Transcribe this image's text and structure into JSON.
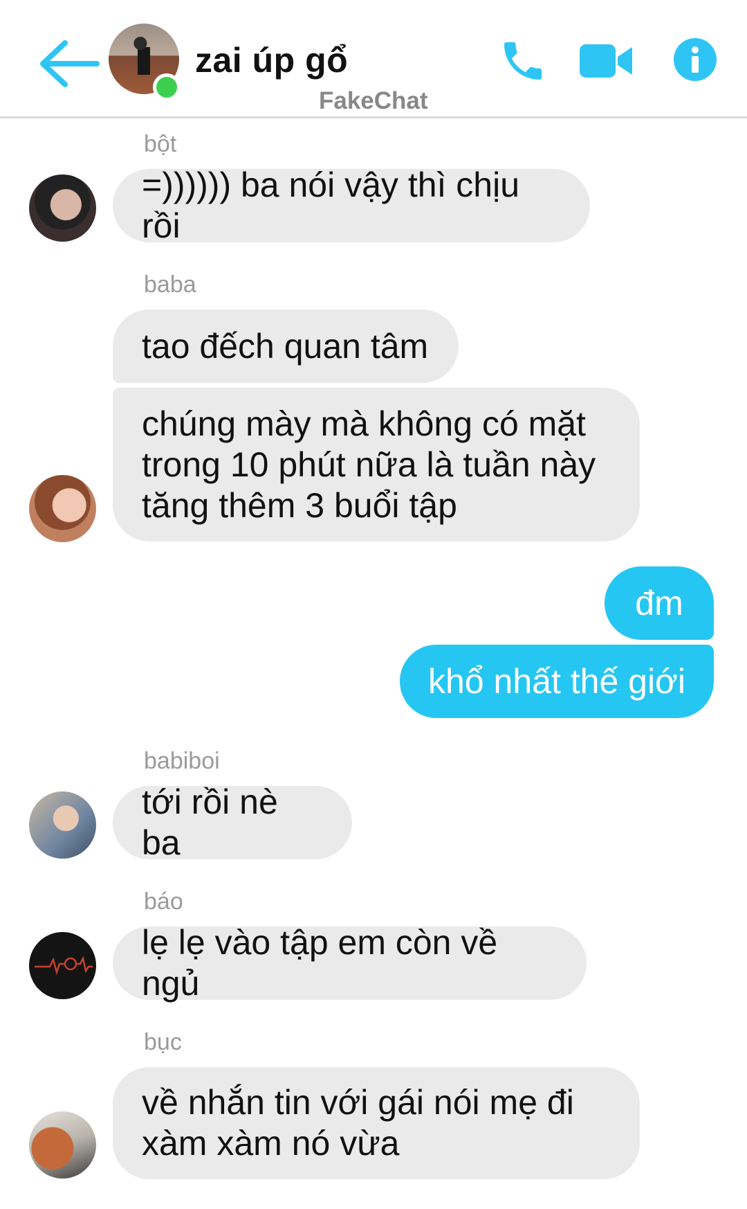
{
  "header": {
    "title": "zai úp gổ",
    "watermark": "FakeChat",
    "online": true,
    "accent_color": "#2ec5f5",
    "icons": [
      "back-arrow-icon",
      "phone-call-icon",
      "video-call-icon",
      "info-icon"
    ]
  },
  "messages": [
    {
      "sender": "bột",
      "text": "=)))))) ba nói vậy thì chịu rồi",
      "direction": "incoming"
    },
    {
      "sender": "baba",
      "text": "tao đếch quan tâm",
      "direction": "incoming"
    },
    {
      "sender": "baba",
      "text": "chúng mày mà không có mặt\ntrong 10 phút nữa là tuần này\ntăng thêm 3 buổi tập",
      "direction": "incoming"
    },
    {
      "sender": "",
      "text": "đm",
      "direction": "outgoing"
    },
    {
      "sender": "",
      "text": "khổ nhất thế giới",
      "direction": "outgoing"
    },
    {
      "sender": "babiboi",
      "text": "tới rồi nè ba",
      "direction": "incoming"
    },
    {
      "sender": "báo",
      "text": "lẹ lẹ vào tập em còn về ngủ",
      "direction": "incoming"
    },
    {
      "sender": "bục",
      "text": "về nhắn tin với gái nói mẹ đi\nxàm xàm nó vừa",
      "direction": "incoming"
    }
  ],
  "colors": {
    "incoming_bubble": "#eaeaea",
    "outgoing_bubble": "#26c6f2",
    "sender_name": "#9a9a9a",
    "online_dot": "#3ccf4e"
  }
}
